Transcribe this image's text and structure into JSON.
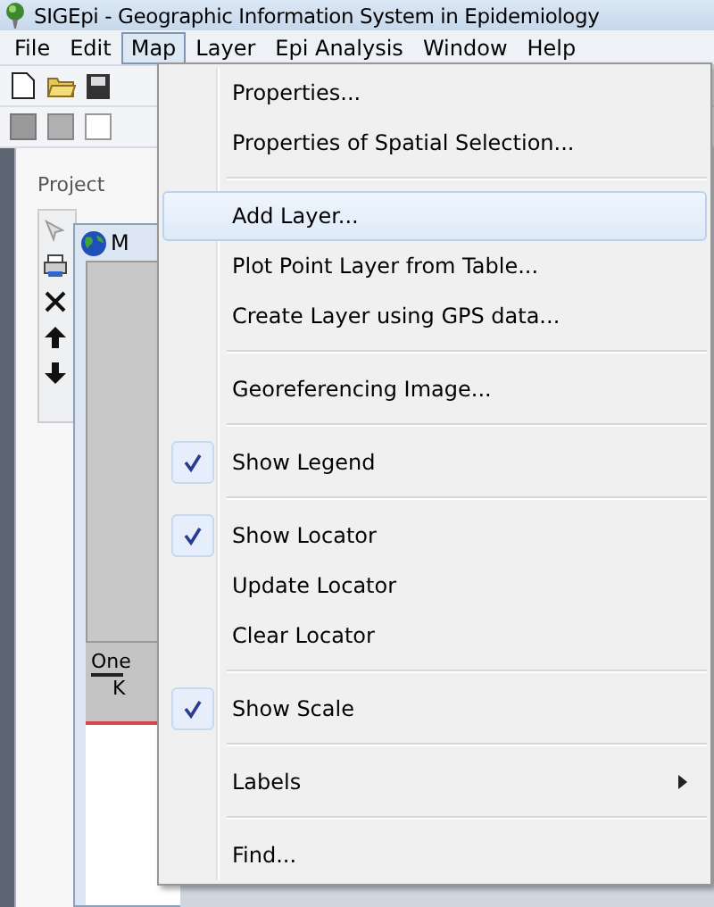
{
  "window": {
    "title": "SIGEpi - Geographic Information System in Epidemiology"
  },
  "menu_bar": [
    {
      "label": "File",
      "selected": false
    },
    {
      "label": "Edit",
      "selected": false
    },
    {
      "label": "Map",
      "selected": true
    },
    {
      "label": "Layer",
      "selected": false
    },
    {
      "label": "Epi Analysis",
      "selected": false
    },
    {
      "label": "Window",
      "selected": false
    },
    {
      "label": "Help",
      "selected": false
    }
  ],
  "project_panel": {
    "title": "Project"
  },
  "map_window": {
    "title": "M",
    "scale_label": "One",
    "scale_unit": "K"
  },
  "menu": [
    {
      "kind": "item",
      "label": "Properties...",
      "checked": false,
      "selected": false,
      "submenu": false
    },
    {
      "kind": "item",
      "label": "Properties of Spatial Selection...",
      "checked": false,
      "selected": false,
      "submenu": false
    },
    {
      "kind": "separator"
    },
    {
      "kind": "item",
      "label": "Add Layer...",
      "checked": false,
      "selected": true,
      "submenu": false
    },
    {
      "kind": "item",
      "label": "Plot Point Layer from Table...",
      "checked": false,
      "selected": false,
      "submenu": false
    },
    {
      "kind": "item",
      "label": "Create Layer using GPS data...",
      "checked": false,
      "selected": false,
      "submenu": false
    },
    {
      "kind": "separator"
    },
    {
      "kind": "item",
      "label": "Georeferencing Image...",
      "checked": false,
      "selected": false,
      "submenu": false
    },
    {
      "kind": "separator"
    },
    {
      "kind": "item",
      "label": "Show Legend",
      "checked": true,
      "selected": false,
      "submenu": false
    },
    {
      "kind": "separator"
    },
    {
      "kind": "item",
      "label": "Show Locator",
      "checked": true,
      "selected": false,
      "submenu": false
    },
    {
      "kind": "item",
      "label": "Update Locator",
      "checked": false,
      "selected": false,
      "submenu": false
    },
    {
      "kind": "item",
      "label": "Clear Locator",
      "checked": false,
      "selected": false,
      "submenu": false
    },
    {
      "kind": "separator"
    },
    {
      "kind": "item",
      "label": "Show Scale",
      "checked": true,
      "selected": false,
      "submenu": false
    },
    {
      "kind": "separator"
    },
    {
      "kind": "item",
      "label": "Labels",
      "checked": false,
      "selected": false,
      "submenu": true
    },
    {
      "kind": "separator"
    },
    {
      "kind": "item",
      "label": "Find...",
      "checked": false,
      "selected": false,
      "submenu": false
    }
  ]
}
